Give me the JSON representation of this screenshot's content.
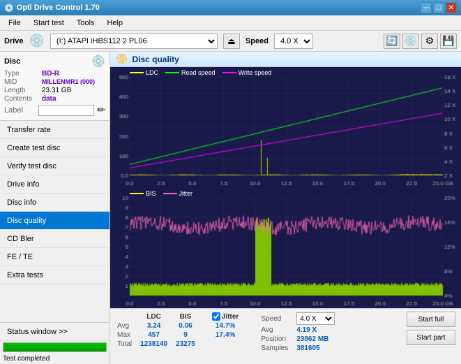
{
  "titleBar": {
    "icon": "💿",
    "title": "Opti Drive Control 1.70",
    "minimizeLabel": "─",
    "maximizeLabel": "□",
    "closeLabel": "✕"
  },
  "menuBar": {
    "items": [
      "File",
      "Start test",
      "Tools",
      "Help"
    ]
  },
  "driveBar": {
    "label": "Drive",
    "driveValue": "(I:)  ATAPI iHBS112  2 PL06",
    "speedLabel": "Speed",
    "speedValue": "4.0 X"
  },
  "disc": {
    "title": "Disc",
    "type": {
      "label": "Type",
      "value": "BD-R"
    },
    "mid": {
      "label": "MID",
      "value": "MILLENMR1 (000)"
    },
    "length": {
      "label": "Length",
      "value": "23.31 GB"
    },
    "contents": {
      "label": "Contents",
      "value": "data"
    },
    "labelField": {
      "label": "Label",
      "value": ""
    }
  },
  "navItems": [
    {
      "id": "transfer-rate",
      "label": "Transfer rate"
    },
    {
      "id": "create-test-disc",
      "label": "Create test disc"
    },
    {
      "id": "verify-test-disc",
      "label": "Verify test disc"
    },
    {
      "id": "drive-info",
      "label": "Drive info"
    },
    {
      "id": "disc-info",
      "label": "Disc info"
    },
    {
      "id": "disc-quality",
      "label": "Disc quality",
      "active": true
    },
    {
      "id": "cd-bler",
      "label": "CD Bler"
    },
    {
      "id": "fe-te",
      "label": "FE / TE"
    },
    {
      "id": "extra-tests",
      "label": "Extra tests"
    }
  ],
  "statusWindow": {
    "label": "Status window >>",
    "progressValue": 100,
    "statusText": "Test completed"
  },
  "panel": {
    "title": "Disc quality",
    "charts": {
      "topLegend": [
        {
          "id": "ldc",
          "color": "#ffff00",
          "label": "LDC"
        },
        {
          "id": "read-speed",
          "color": "#00ff00",
          "label": "Read speed"
        },
        {
          "id": "write-speed",
          "color": "#ff00ff",
          "label": "Write speed"
        }
      ],
      "bottomLegend": [
        {
          "id": "bis",
          "color": "#ffff00",
          "label": "BIS"
        },
        {
          "id": "jitter",
          "color": "#ff69b4",
          "label": "Jitter"
        }
      ],
      "topYLabels": [
        "500",
        "400",
        "300",
        "200",
        "100",
        "0.0"
      ],
      "topYLabelsRight": [
        "18 X",
        "14 X",
        "12 X",
        "10 X",
        "8 X",
        "6 X",
        "4 X",
        "2 X"
      ],
      "bottomYLabels": [
        "10",
        "9",
        "8",
        "7",
        "6",
        "5",
        "4",
        "3",
        "2",
        "1"
      ],
      "bottomYLabelsRight": [
        "20%",
        "16%",
        "12%",
        "8%",
        "4%"
      ],
      "xLabels": [
        "0.0",
        "2.5",
        "5.0",
        "7.5",
        "10.0",
        "12.5",
        "15.0",
        "17.5",
        "20.0",
        "22.5",
        "25.0 GB"
      ]
    }
  },
  "stats": {
    "columns": [
      "LDC",
      "BIS",
      "",
      "Jitter",
      "Speed"
    ],
    "rows": [
      {
        "label": "Avg",
        "ldc": "3.24",
        "bis": "0.06",
        "jitter": "14.7%",
        "speed": "4.19 X"
      },
      {
        "label": "Max",
        "ldc": "457",
        "bis": "9",
        "jitter": "17.4%",
        "position": "23862 MB"
      },
      {
        "label": "Total",
        "ldc": "1238140",
        "bis": "23275",
        "samples": "381605"
      }
    ],
    "speedDropdown": "4.0 X",
    "buttons": {
      "startFull": "Start full",
      "startPart": "Start part"
    },
    "positionLabel": "Position",
    "samplesLabel": "Samples"
  }
}
